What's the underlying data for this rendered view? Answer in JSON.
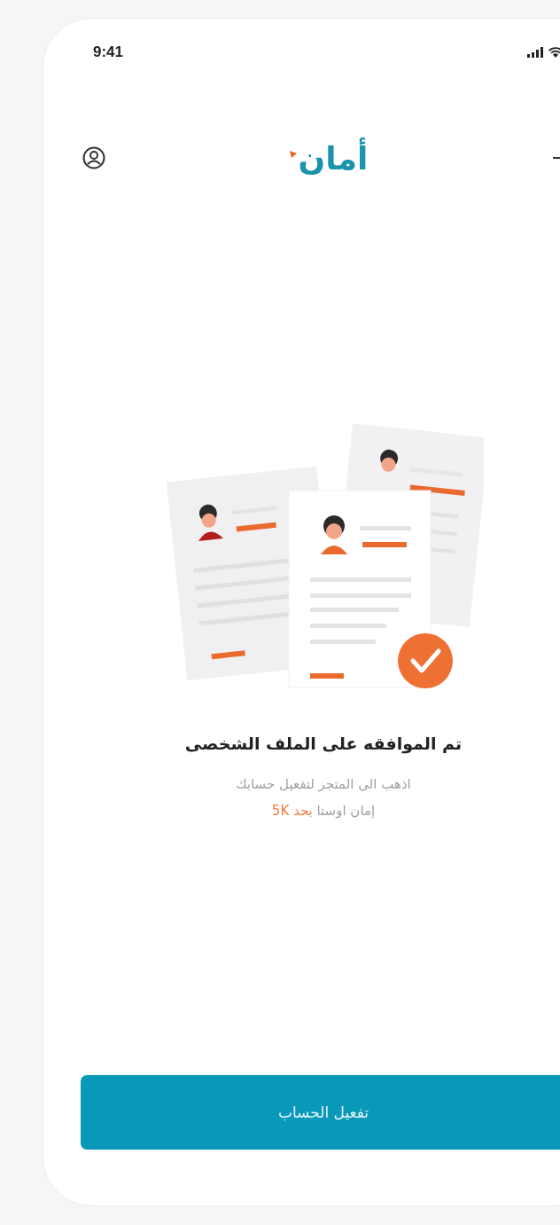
{
  "status_bar": {
    "time": "9:41"
  },
  "header": {
    "logo": "أمان"
  },
  "message": {
    "title": "تم الموافقه على الملف الشخصى",
    "line1": "اذهب الى المتجر لتفعيل حسابك",
    "line2": "إمان اوستا",
    "highlight": "بحد 5K"
  },
  "button": {
    "label": "تفعيل الحساب"
  }
}
